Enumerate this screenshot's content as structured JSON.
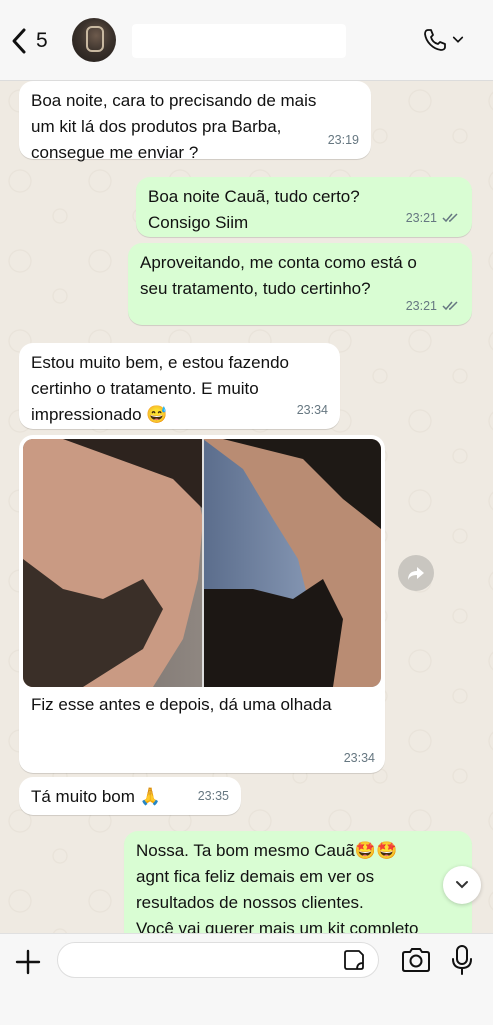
{
  "header": {
    "back_count": "5",
    "contact_name": ""
  },
  "messages": [
    {
      "text": "Boa noite, cara to precisando de mais\num kit lá dos produtos pra Barba,\nconsegue me enviar ?",
      "time": "23:19",
      "direction": "in"
    },
    {
      "text": "Boa noite Cauã, tudo certo?\nConsigo Siim",
      "time": "23:21",
      "direction": "out"
    },
    {
      "text": "Aproveitando, me conta como está o\nseu tratamento, tudo certinho?",
      "time": "23:21",
      "direction": "out"
    },
    {
      "text": "Estou muito bem, e estou fazendo\ncertinho o tratamento. E muito\nimpressionado 😅",
      "time": "23:34",
      "direction": "in"
    },
    {
      "text": "Fiz esse antes e depois, dá uma olhada",
      "time": "23:34",
      "direction": "in"
    },
    {
      "text": "Tá muito bom 🙏",
      "time": "23:35",
      "direction": "in"
    },
    {
      "text": "Nossa. Ta bom mesmo Cauã🤩🤩\nagnt fica feliz demais em ver os\nresultados de nossos clientes.\nVocê vai querer mais um kit completo",
      "time": "",
      "direction": "out"
    }
  ],
  "composer": {
    "placeholder": ""
  },
  "colors": {
    "incoming": "#ffffff",
    "outgoing": "#d9fdd3",
    "background": "#efeae2",
    "read_ticks": "#667781"
  },
  "icons": [
    "back-chevron-icon",
    "phone-icon",
    "chevron-down-icon",
    "forward-icon",
    "scroll-down-icon",
    "plus-icon",
    "sticker-icon",
    "camera-icon",
    "microphone-icon"
  ]
}
